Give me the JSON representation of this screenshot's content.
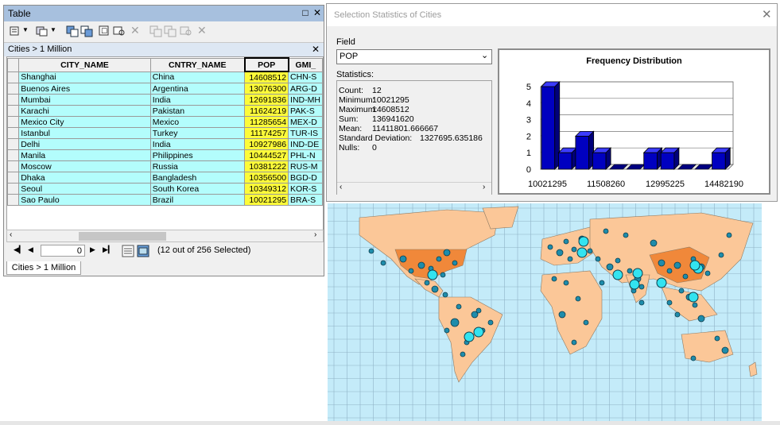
{
  "table_window": {
    "title": "Table",
    "layer_tab": "Cities > 1 Million",
    "columns": [
      "CITY_NAME",
      "CNTRY_NAME",
      "POP",
      "GMI_"
    ],
    "rows": [
      {
        "city": "Shanghai",
        "country": "China",
        "pop": "14608512",
        "gmi": "CHN-S"
      },
      {
        "city": "Buenos Aires",
        "country": "Argentina",
        "pop": "13076300",
        "gmi": "ARG-D"
      },
      {
        "city": "Mumbai",
        "country": "India",
        "pop": "12691836",
        "gmi": "IND-MH"
      },
      {
        "city": "Karachi",
        "country": "Pakistan",
        "pop": "11624219",
        "gmi": "PAK-S"
      },
      {
        "city": "Mexico City",
        "country": "Mexico",
        "pop": "11285654",
        "gmi": "MEX-D"
      },
      {
        "city": "Istanbul",
        "country": "Turkey",
        "pop": "11174257",
        "gmi": "TUR-IS"
      },
      {
        "city": "Delhi",
        "country": "India",
        "pop": "10927986",
        "gmi": "IND-DE"
      },
      {
        "city": "Manila",
        "country": "Philippines",
        "pop": "10444527",
        "gmi": "PHL-N"
      },
      {
        "city": "Moscow",
        "country": "Russia",
        "pop": "10381222",
        "gmi": "RUS-M"
      },
      {
        "city": "Dhaka",
        "country": "Bangladesh",
        "pop": "10356500",
        "gmi": "BGD-D"
      },
      {
        "city": "Seoul",
        "country": "South Korea",
        "pop": "10349312",
        "gmi": "KOR-S"
      },
      {
        "city": "Sao Paulo",
        "country": "Brazil",
        "pop": "10021295",
        "gmi": "BRA-S"
      }
    ],
    "record_value": "0",
    "selected_text": "(12 out of 256 Selected)",
    "bottom_tab": "Cities > 1 Million"
  },
  "stats_dialog": {
    "title": "Selection Statistics of Cities",
    "field_label": "Field",
    "field_value": "POP",
    "statistics_label": "Statistics:",
    "stats": [
      {
        "label": "Count:",
        "value": "12"
      },
      {
        "label": "Minimum:",
        "value": "10021295"
      },
      {
        "label": "Maximum:",
        "value": "14608512"
      },
      {
        "label": "Sum:",
        "value": "136941620"
      },
      {
        "label": "Mean:",
        "value": "11411801.666667"
      },
      {
        "label": "Standard Deviation:",
        "value": "1327695.635186"
      },
      {
        "label": "Nulls:",
        "value": "0"
      }
    ]
  },
  "chart_data": {
    "type": "bar",
    "title": "Frequency Distribution",
    "x_tick_labels": [
      "10021295",
      "11508260",
      "12995225",
      "14482190"
    ],
    "values": [
      5,
      1,
      2,
      1,
      0,
      0,
      1,
      1,
      0,
      0,
      1
    ],
    "ylim": [
      0,
      5
    ],
    "y_ticks": [
      0,
      1,
      2,
      3,
      4,
      5
    ],
    "bar_color": "#0000c0",
    "grid": true
  },
  "colors": {
    "row_highlight": "#b3fdfc",
    "pop_highlight": "#fdfb39",
    "titlebar": "#a7c0de",
    "ocean": "#c4ebf9",
    "land": "#fbc798",
    "selected_country": "#f0883a",
    "city_dot": "#1e8cab",
    "selected_city": "#33e3f0"
  }
}
